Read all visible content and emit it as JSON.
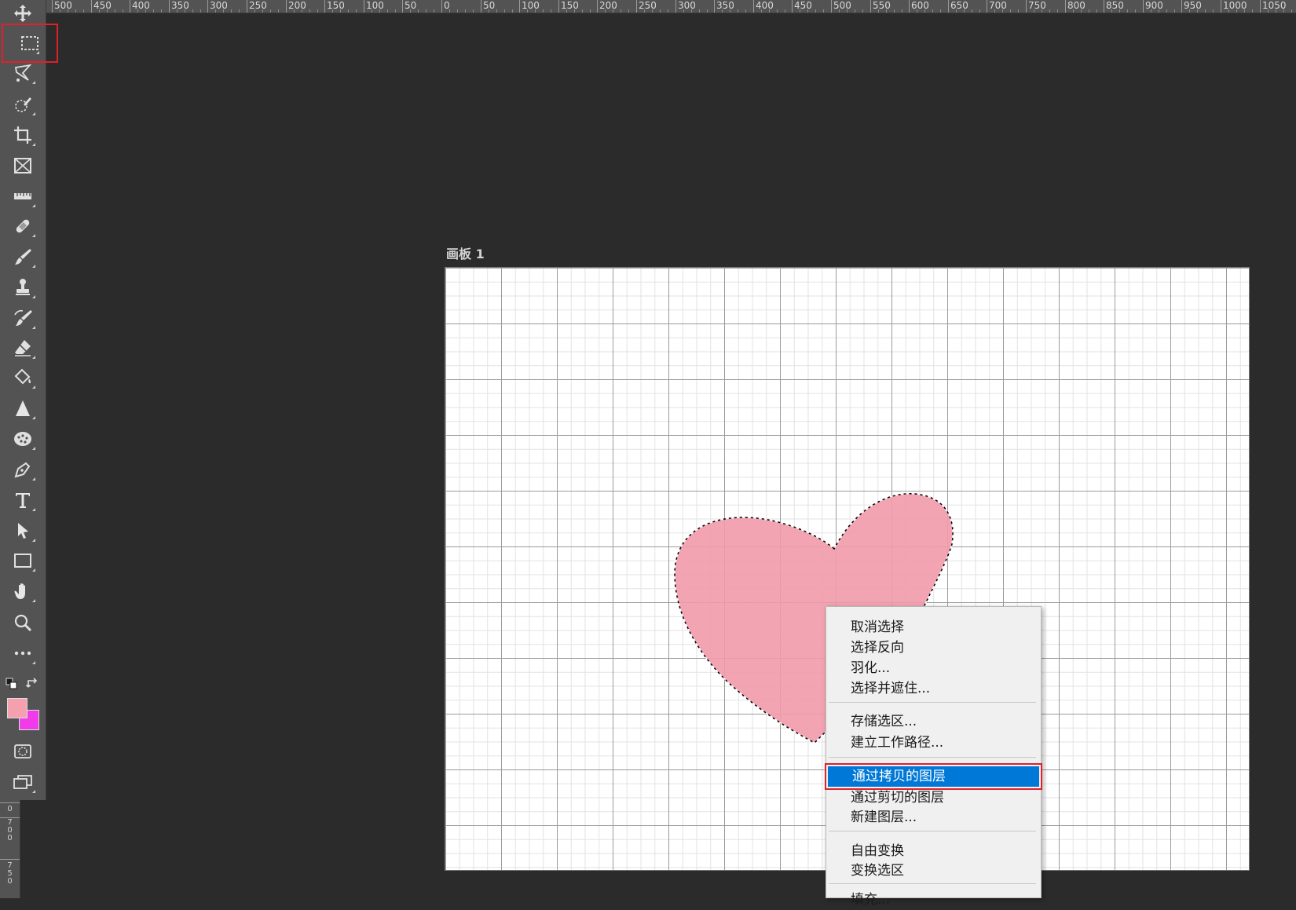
{
  "ruler": {
    "top_labels": [
      "500",
      "450",
      "400",
      "350",
      "300",
      "250",
      "200",
      "150",
      "100",
      "50",
      "0",
      "50",
      "100",
      "150",
      "200",
      "250",
      "300",
      "350",
      "400",
      "450",
      "500",
      "550",
      "600",
      "650",
      "700",
      "750",
      "800",
      "850",
      "900",
      "950",
      "1000",
      "1050"
    ],
    "left_labels": [
      "0",
      "700",
      "750"
    ]
  },
  "toolbar": {
    "tools": [
      {
        "name": "move-tool",
        "icon": "move-icon"
      },
      {
        "name": "rectangular-marquee-tool",
        "icon": "marquee-icon",
        "active": true
      },
      {
        "name": "lasso-tool",
        "icon": "lasso-icon"
      },
      {
        "name": "quick-selection-tool",
        "icon": "quick-selection-icon"
      },
      {
        "name": "crop-tool",
        "icon": "crop-icon"
      },
      {
        "name": "frame-tool",
        "icon": "frame-icon"
      },
      {
        "name": "ruler-tool",
        "icon": "ruler-icon"
      },
      {
        "name": "healing-brush-tool",
        "icon": "bandage-icon"
      },
      {
        "name": "brush-tool",
        "icon": "brush-icon"
      },
      {
        "name": "clone-stamp-tool",
        "icon": "stamp-icon"
      },
      {
        "name": "history-brush-tool",
        "icon": "history-brush-icon"
      },
      {
        "name": "eraser-tool",
        "icon": "eraser-icon"
      },
      {
        "name": "paint-bucket-tool",
        "icon": "paint-bucket-icon"
      },
      {
        "name": "sharpen-tool",
        "icon": "triangle-icon"
      },
      {
        "name": "sponge-tool",
        "icon": "sponge-icon"
      },
      {
        "name": "pen-tool",
        "icon": "pen-icon"
      },
      {
        "name": "type-tool",
        "icon": "type-icon"
      },
      {
        "name": "path-selection-tool",
        "icon": "arrow-pointer-icon"
      },
      {
        "name": "rectangle-tool",
        "icon": "rectangle-icon"
      },
      {
        "name": "hand-tool",
        "icon": "hand-icon"
      },
      {
        "name": "zoom-tool",
        "icon": "magnifier-icon"
      },
      {
        "name": "edit-toolbar",
        "icon": "ellipsis-icon"
      }
    ],
    "foreground_color": "#f4a0ae",
    "background_color": "#f03ce8"
  },
  "artboard": {
    "label": "画板 1",
    "background": "#ffffff",
    "heart_color": "#f29aaa"
  },
  "context_menu": {
    "groups": [
      [
        "取消选择",
        "选择反向",
        "羽化...",
        "选择并遮住..."
      ],
      [
        "存储选区...",
        "建立工作路径..."
      ],
      [
        "通过拷贝的图层",
        "通过剪切的图层",
        "新建图层..."
      ],
      [
        "自由变换",
        "变换选区"
      ],
      [
        "填充..."
      ]
    ],
    "highlighted": "通过拷贝的图层",
    "highlight_color": "#0078d7"
  }
}
